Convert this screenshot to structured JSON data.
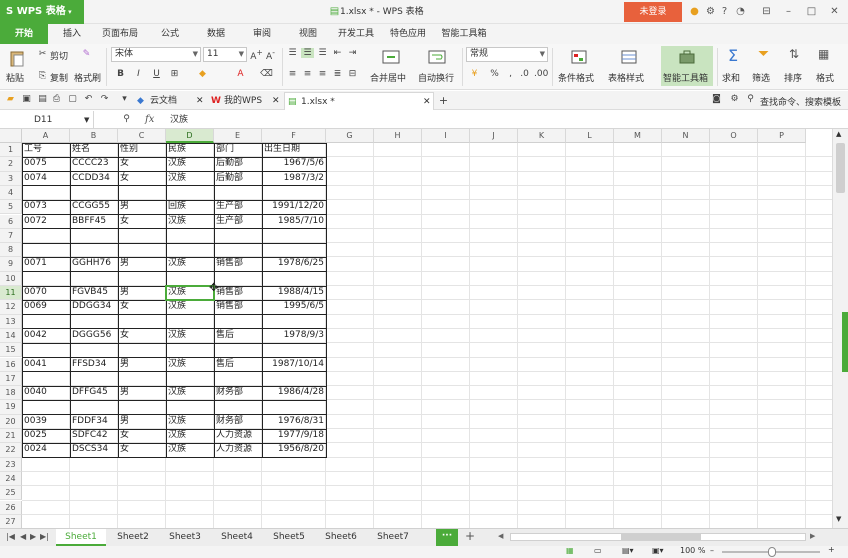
{
  "titlebar": {
    "app_name": "WPS 表格",
    "doc_title": "1.xlsx * - WPS 表格",
    "login": "未登录"
  },
  "menu": {
    "tabs": [
      "开始",
      "插入",
      "页面布局",
      "公式",
      "数据",
      "审阅",
      "视图",
      "开发工具",
      "特色应用",
      "智能工具箱"
    ],
    "active": "开始"
  },
  "ribbon": {
    "paste": "粘贴",
    "cut": "剪切",
    "copy": "复制",
    "format_painter": "格式刷",
    "font_name": "宋体",
    "font_size": "11",
    "bold": "B",
    "italic": "I",
    "underline": "U",
    "merge_center": "合并居中",
    "wrap": "自动换行",
    "number_format": "常规",
    "percent": "%",
    "cond_format": "条件格式",
    "table_style": "表格样式",
    "smart_toolbox": "智能工具箱",
    "sum": "求和",
    "filter": "筛选",
    "sort": "排序",
    "format": "格式"
  },
  "doctabs": {
    "cloud": "云文档",
    "mywps": "我的WPS",
    "file": "1.xlsx *",
    "search": "查找命令、搜索模板"
  },
  "formula_bar": {
    "cell_ref": "D11",
    "fx": "fx",
    "content": "汉族"
  },
  "columns": [
    "A",
    "B",
    "C",
    "D",
    "E",
    "F",
    "G",
    "H",
    "I",
    "J",
    "K",
    "L",
    "M",
    "N",
    "O",
    "P"
  ],
  "row_numbers": [
    "1",
    "2",
    "3",
    "4",
    "5",
    "6",
    "7",
    "8",
    "9",
    "10",
    "11",
    "12",
    "13",
    "14",
    "15",
    "16",
    "17",
    "18",
    "19",
    "20",
    "21",
    "22",
    "23",
    "24",
    "25",
    "26",
    "27"
  ],
  "rows": [
    [
      "工号",
      "姓名",
      "性别",
      "民族",
      "部门",
      "出生日期"
    ],
    [
      "0075",
      "CCCC23",
      "女",
      "汉族",
      "后勤部",
      "1967/5/6"
    ],
    [
      "0074",
      "CCDD34",
      "女",
      "汉族",
      "后勤部",
      "1987/3/2"
    ],
    [
      "",
      "",
      "",
      "",
      "",
      ""
    ],
    [
      "0073",
      "CCGG55",
      "男",
      "回族",
      "生产部",
      "1991/12/20"
    ],
    [
      "0072",
      "BBFF45",
      "女",
      "汉族",
      "生产部",
      "1985/7/10"
    ],
    [
      "",
      "",
      "",
      "",
      "",
      ""
    ],
    [
      "",
      "",
      "",
      "",
      "",
      ""
    ],
    [
      "0071",
      "GGHH76",
      "男",
      "汉族",
      "销售部",
      "1978/6/25"
    ],
    [
      "",
      "",
      "",
      "",
      "",
      ""
    ],
    [
      "0070",
      "FGVB45",
      "男",
      "汉族",
      "销售部",
      "1988/4/15"
    ],
    [
      "0069",
      "DDGG34",
      "女",
      "汉族",
      "销售部",
      "1995/6/5"
    ],
    [
      "",
      "",
      "",
      "",
      "",
      ""
    ],
    [
      "0042",
      "DGGG56",
      "女",
      "汉族",
      "售后",
      "1978/9/3"
    ],
    [
      "",
      "",
      "",
      "",
      "",
      ""
    ],
    [
      "0041",
      "FFSD34",
      "男",
      "汉族",
      "售后",
      "1987/10/14"
    ],
    [
      "",
      "",
      "",
      "",
      "",
      ""
    ],
    [
      "0040",
      "DFFG45",
      "男",
      "汉族",
      "财务部",
      "1986/4/28"
    ],
    [
      "",
      "",
      "",
      "",
      "",
      ""
    ],
    [
      "0039",
      "FDDF34",
      "男",
      "汉族",
      "财务部",
      "1976/8/31"
    ],
    [
      "0025",
      "SDFC42",
      "女",
      "汉族",
      "人力资源",
      "1977/9/18"
    ],
    [
      "0024",
      "DSCS34",
      "女",
      "汉族",
      "人力资源",
      "1956/8/20"
    ]
  ],
  "selected": {
    "row": 11,
    "col": "D"
  },
  "sheets": [
    "Sheet1",
    "Sheet2",
    "Sheet3",
    "Sheet4",
    "Sheet5",
    "Sheet6",
    "Sheet7"
  ],
  "active_sheet": "Sheet1",
  "status": {
    "zoom": "100 %"
  },
  "colors": {
    "accent": "#4bab3a",
    "login": "#e8613c"
  }
}
